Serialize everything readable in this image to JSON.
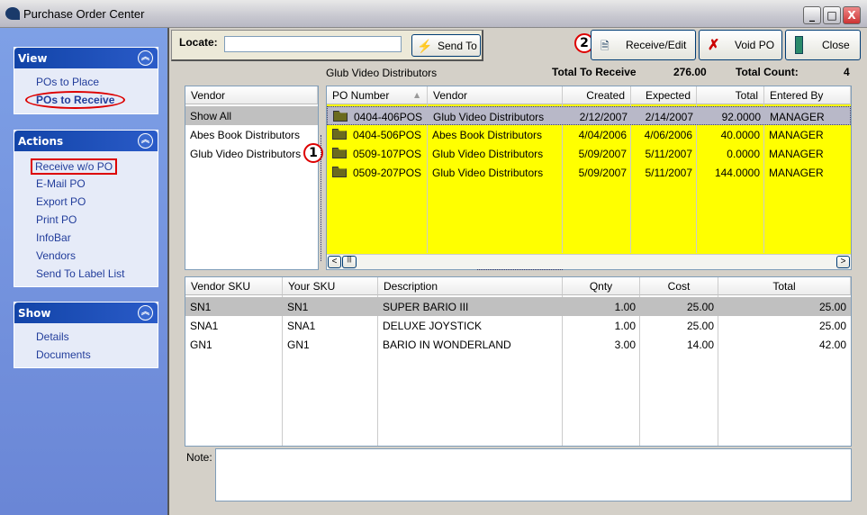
{
  "window": {
    "title": "Purchase Order Center"
  },
  "sidebar": {
    "view": {
      "title": "View",
      "items": [
        "POs to Place",
        "POs to Receive"
      ]
    },
    "actions": {
      "title": "Actions",
      "items": [
        "Receive w/o PO",
        "E-Mail PO",
        "Export PO",
        "Print PO",
        "InfoBar",
        "Vendors",
        "Send To Label List"
      ]
    },
    "show": {
      "title": "Show",
      "items": [
        "Details",
        "Documents"
      ]
    }
  },
  "toolbar": {
    "locate_label": "Locate:",
    "locate_value": "",
    "send_to": "Send To",
    "receive_edit": "Receive/Edit",
    "void_po": "Void PO",
    "close": "Close",
    "marker": "2"
  },
  "info": {
    "vendor": "Glub Video Distributors",
    "total_label": "Total To Receive",
    "total_value": "276.00",
    "count_label": "Total Count:",
    "count_value": "4"
  },
  "vendor_list": {
    "header": "Vendor",
    "items": [
      "Show All",
      "Abes Book Distributors",
      "Glub Video Distributors"
    ],
    "marker": "1"
  },
  "po_grid": {
    "columns": [
      "PO Number",
      "Vendor",
      "Created",
      "Expected",
      "Total",
      "Entered By"
    ],
    "rows": [
      [
        "0404-406POS",
        "Glub Video Distributors",
        "2/12/2007",
        "2/14/2007",
        "92.0000",
        "MANAGER"
      ],
      [
        "0404-506POS",
        "Abes Book Distributors",
        "4/04/2006",
        "4/06/2006",
        "40.0000",
        "MANAGER"
      ],
      [
        "0509-107POS",
        "Glub Video Distributors",
        "5/09/2007",
        "5/11/2007",
        "0.0000",
        "MANAGER"
      ],
      [
        "0509-207POS",
        "Glub Video Distributors",
        "5/09/2007",
        "5/11/2007",
        "144.0000",
        "MANAGER"
      ]
    ],
    "highlight_color": "#ffff00"
  },
  "items_grid": {
    "columns": [
      "Vendor SKU",
      "Your SKU",
      "Description",
      "Qnty",
      "Cost",
      "Total"
    ],
    "rows": [
      [
        "SN1",
        "SN1",
        "SUPER BARIO III",
        "1.00",
        "25.00",
        "25.00"
      ],
      [
        "SNA1",
        "SNA1",
        "DELUXE JOYSTICK",
        "1.00",
        "25.00",
        "25.00"
      ],
      [
        "GN1",
        "GN1",
        "BARIO IN WONDERLAND",
        "3.00",
        "14.00",
        "42.00"
      ]
    ]
  },
  "note": {
    "label": "Note:",
    "value": ""
  }
}
